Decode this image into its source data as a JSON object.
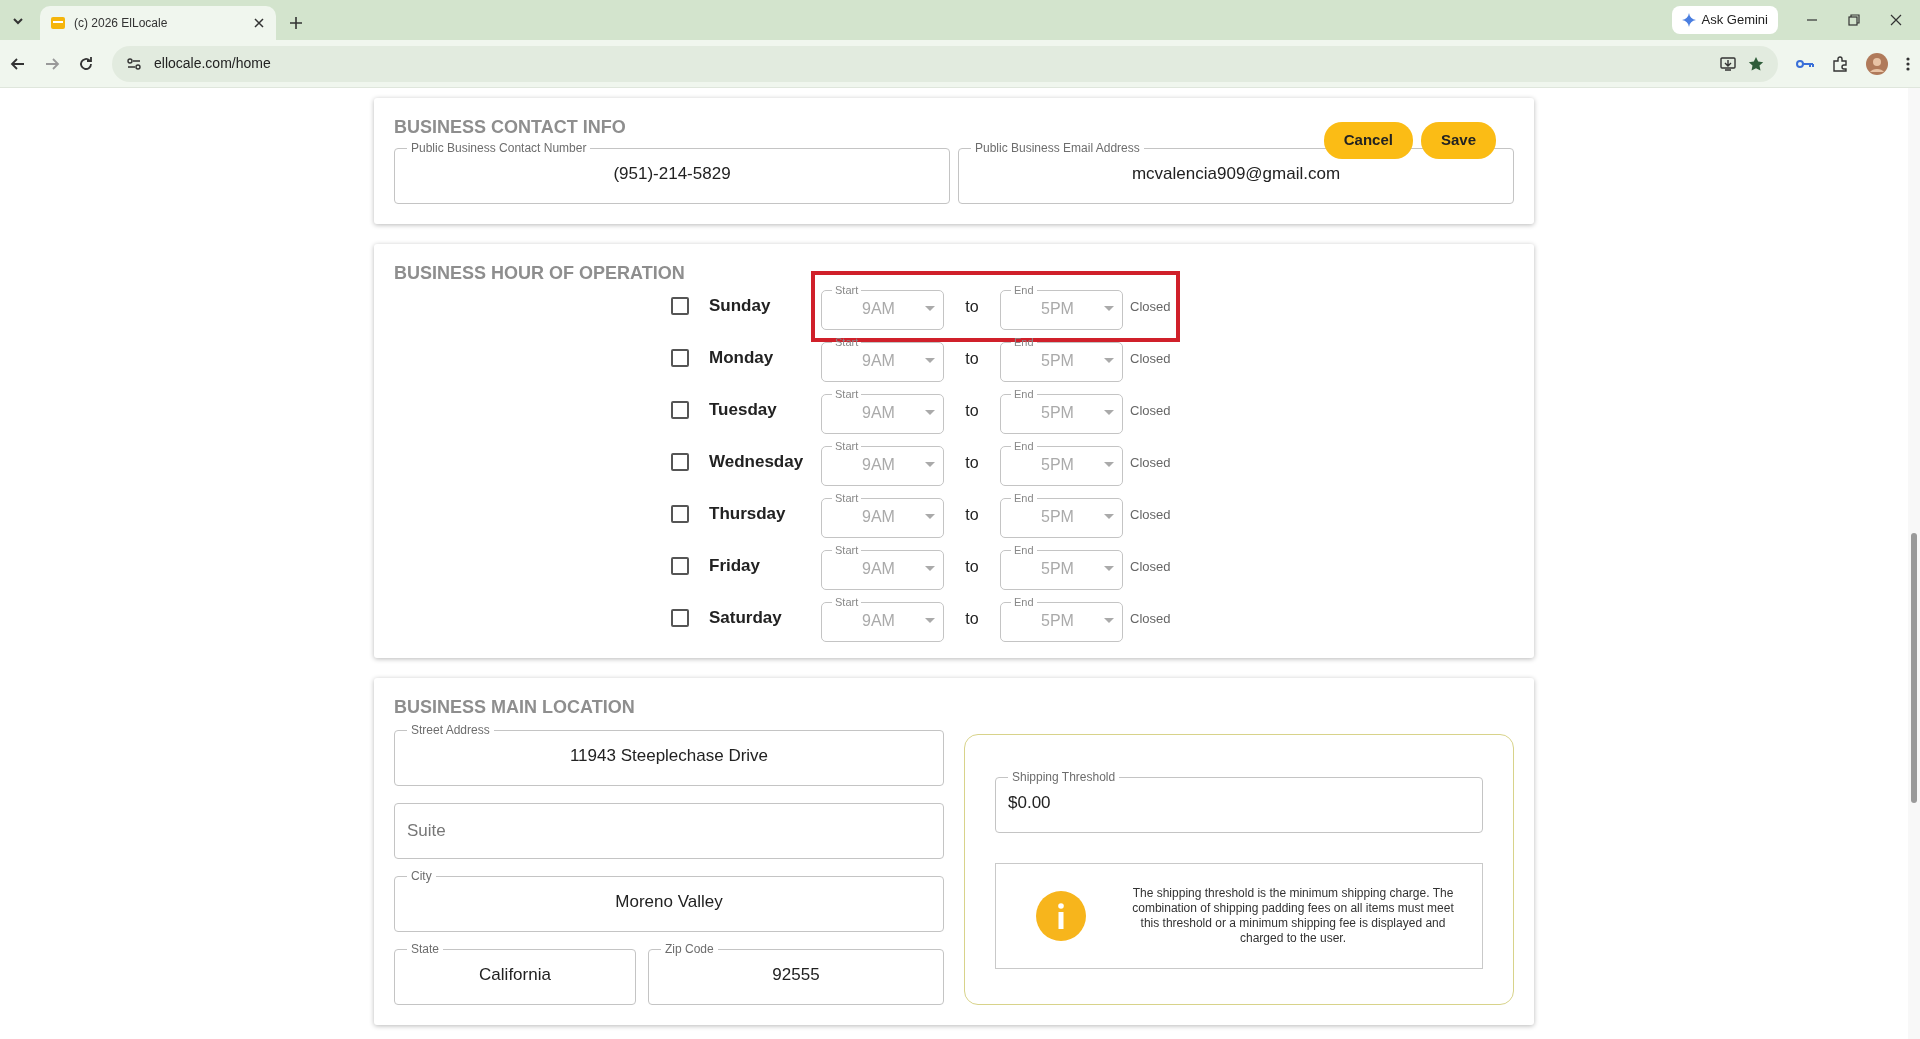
{
  "browser": {
    "tab_title": "(c) 2026 ElLocale",
    "url": "ellocale.com/home",
    "gemini_label": "Ask Gemini"
  },
  "contact": {
    "title": "BUSINESS CONTACT INFO",
    "fields": [
      {
        "label": "Public Business Contact Number",
        "value": "(951)-214-5829"
      },
      {
        "label": "Public Business Email Address",
        "value": "mcvalencia909@gmail.com"
      }
    ],
    "buttons": [
      "Cancel",
      "Save"
    ]
  },
  "hours": {
    "title": "BUSINESS HOUR OF OPERATION",
    "days": [
      {
        "name": "Sunday",
        "checked": false,
        "highlighted": true,
        "disabled": true,
        "start_label": "Start",
        "start": "9AM",
        "separator": "to",
        "end_label": "End",
        "end": "5PM",
        "status": "Closed"
      },
      {
        "name": "Monday",
        "checked": false,
        "highlighted": false,
        "disabled": true,
        "start_label": "Start",
        "start": "9AM",
        "separator": "to",
        "end_label": "End",
        "end": "5PM",
        "status": "Closed"
      },
      {
        "name": "Tuesday",
        "checked": false,
        "highlighted": false,
        "disabled": true,
        "start_label": "Start",
        "start": "9AM",
        "separator": "to",
        "end_label": "End",
        "end": "5PM",
        "status": "Closed"
      },
      {
        "name": "Wednesday",
        "checked": false,
        "highlighted": false,
        "disabled": true,
        "start_label": "Start",
        "start": "9AM",
        "separator": "to",
        "end_label": "End",
        "end": "5PM",
        "status": "Closed"
      },
      {
        "name": "Thursday",
        "checked": false,
        "highlighted": false,
        "disabled": true,
        "start_label": "Start",
        "start": "9AM",
        "separator": "to",
        "end_label": "End",
        "end": "5PM",
        "status": "Closed"
      },
      {
        "name": "Friday",
        "checked": false,
        "highlighted": false,
        "disabled": true,
        "start_label": "Start",
        "start": "9AM",
        "separator": "to",
        "end_label": "End",
        "end": "5PM",
        "status": "Closed"
      },
      {
        "name": "Saturday",
        "checked": false,
        "highlighted": false,
        "disabled": true,
        "start_label": "Start",
        "start": "9AM",
        "separator": "to",
        "end_label": "End",
        "end": "5PM",
        "status": "Closed"
      }
    ]
  },
  "location": {
    "title": "BUSINESS MAIN LOCATION",
    "street": {
      "label": "Street Address",
      "value": "11943 Steeplechase Drive"
    },
    "suite": {
      "placeholder": "Suite"
    },
    "city": {
      "label": "City",
      "value": "Moreno Valley"
    },
    "state": {
      "label": "State",
      "value": "California"
    },
    "zip": {
      "label": "Zip Code",
      "value": "92555"
    }
  },
  "shipping": {
    "label": "Shipping Threshold",
    "value": "$0.00",
    "info": "The shipping threshold is the minimum shipping charge. The combination of shipping padding fees on all items must meet this threshold or a minimum shipping fee is displayed and charged to the user."
  }
}
